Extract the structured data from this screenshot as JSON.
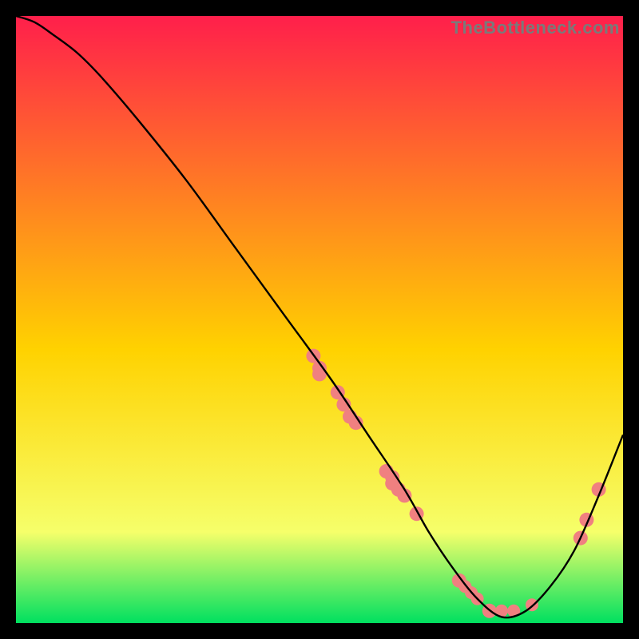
{
  "watermark": "TheBottleneck.com",
  "chart_data": {
    "type": "line",
    "title": "",
    "xlabel": "",
    "ylabel": "",
    "xlim": [
      0,
      100
    ],
    "ylim": [
      0,
      100
    ],
    "grid": false,
    "legend": false,
    "background_gradient_top": "#ff1f4b",
    "background_gradient_mid": "#ffd200",
    "background_gradient_bottom": "#00e060",
    "series": [
      {
        "name": "bottleneck-curve",
        "color": "#000000",
        "x": [
          0,
          3,
          6,
          10,
          14,
          20,
          28,
          36,
          44,
          52,
          58,
          64,
          68,
          72,
          76,
          80,
          84,
          88,
          92,
          96,
          100
        ],
        "y": [
          100,
          99,
          97,
          94,
          90,
          83,
          73,
          62,
          51,
          40,
          31,
          22,
          15,
          9,
          4,
          1,
          2,
          6,
          12,
          21,
          31
        ]
      }
    ],
    "markers": {
      "name": "highlighted-points",
      "color": "#f08080",
      "points": [
        {
          "x": 49,
          "y": 44,
          "r": 9
        },
        {
          "x": 50,
          "y": 42,
          "r": 9
        },
        {
          "x": 50,
          "y": 41,
          "r": 9
        },
        {
          "x": 53,
          "y": 38,
          "r": 9
        },
        {
          "x": 54,
          "y": 36,
          "r": 9
        },
        {
          "x": 55,
          "y": 34,
          "r": 9
        },
        {
          "x": 56,
          "y": 33,
          "r": 9
        },
        {
          "x": 61,
          "y": 25,
          "r": 9
        },
        {
          "x": 62,
          "y": 24,
          "r": 9
        },
        {
          "x": 62,
          "y": 23,
          "r": 9
        },
        {
          "x": 63,
          "y": 22,
          "r": 9
        },
        {
          "x": 64,
          "y": 21,
          "r": 9
        },
        {
          "x": 66,
          "y": 18,
          "r": 9
        },
        {
          "x": 73,
          "y": 7,
          "r": 9
        },
        {
          "x": 74,
          "y": 6,
          "r": 8
        },
        {
          "x": 75,
          "y": 5,
          "r": 8
        },
        {
          "x": 76,
          "y": 4,
          "r": 8
        },
        {
          "x": 78,
          "y": 2,
          "r": 9
        },
        {
          "x": 80,
          "y": 2,
          "r": 8
        },
        {
          "x": 82,
          "y": 2,
          "r": 8
        },
        {
          "x": 85,
          "y": 3,
          "r": 8
        },
        {
          "x": 93,
          "y": 14,
          "r": 9
        },
        {
          "x": 94,
          "y": 17,
          "r": 9
        },
        {
          "x": 96,
          "y": 22,
          "r": 9
        }
      ]
    }
  }
}
